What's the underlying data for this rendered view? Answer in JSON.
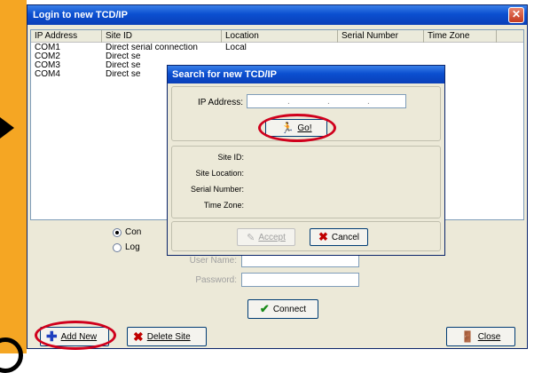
{
  "window": {
    "title": "Login to new TCD/IP",
    "close_glyph": "✕"
  },
  "list": {
    "columns": [
      "IP Address",
      "Site ID",
      "Location",
      "Serial Number",
      "Time Zone"
    ],
    "rows": [
      {
        "ip": "COM1",
        "site": "Direct serial connection",
        "location": "Local"
      },
      {
        "ip": "COM2",
        "site": "Direct se"
      },
      {
        "ip": "COM3",
        "site": "Direct se"
      },
      {
        "ip": "COM4",
        "site": "Direct se"
      }
    ]
  },
  "login_form": {
    "radio1_label": "Con",
    "radio1_checked": true,
    "radio2_label": "Log",
    "radio2_checked": false,
    "user_name_label": "User Name:",
    "password_label": "Password:",
    "user_name_value": "",
    "password_value": ""
  },
  "buttons": {
    "connect": "Connect",
    "add_new": "Add New",
    "delete_site": "Delete Site",
    "close": "Close"
  },
  "dialog": {
    "title": "Search for new TCD/IP",
    "ip_label": "IP Address:",
    "go_label": "Go!",
    "site_id_label": "Site ID:",
    "site_location_label": "Site Location:",
    "serial_number_label": "Serial Number:",
    "time_zone_label": "Time Zone:",
    "accept_label": "Accept",
    "cancel_label": "Cancel"
  },
  "colors": {
    "title_bar": "#0b4fd0",
    "window_bg": "#ece9d8",
    "highlight_ring": "#d0001c",
    "background_strip": "#f5a623"
  }
}
